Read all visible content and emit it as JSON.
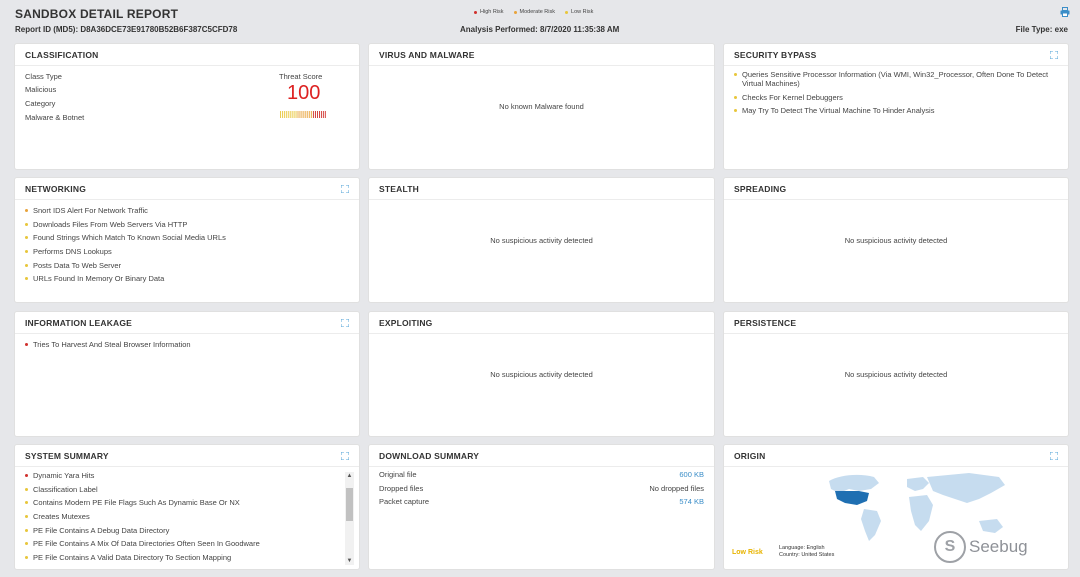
{
  "header": {
    "title": "SANDBOX DETAIL REPORT",
    "report_id": "Report ID (MD5): D8A36DCE73E91780B52B6F387C5CFD78",
    "analysis_performed": "Analysis Performed: 8/7/2020 11:35:38 AM",
    "file_type": "File Type: exe",
    "legend": [
      {
        "label": "High Risk",
        "color": "#d0312d"
      },
      {
        "label": "Moderate Risk",
        "color": "#e8a33b"
      },
      {
        "label": "Low Risk",
        "color": "#e8c63b"
      }
    ]
  },
  "colors": {
    "high": "#d0312d",
    "moderate": "#e8a33b",
    "low": "#e8c63b",
    "link": "#3b8ec8"
  },
  "classification": {
    "title": "CLASSIFICATION",
    "class_type_label": "Class Type",
    "class_type_value": "Malicious",
    "category_label": "Category",
    "category_value": "Malware & Botnet",
    "threat_score_label": "Threat Score",
    "threat_score": "100"
  },
  "virus": {
    "title": "VIRUS AND MALWARE",
    "message": "No known Malware found"
  },
  "security_bypass": {
    "title": "SECURITY BYPASS",
    "items": [
      {
        "text": "Queries Sensitive Processor Information (Via WMI, Win32_Processor, Often Done To Detect Virtual Machines)",
        "risk": "low"
      },
      {
        "text": "Checks For Kernel Debuggers",
        "risk": "low"
      },
      {
        "text": "May Try To Detect The Virtual Machine To Hinder Analysis",
        "risk": "low"
      }
    ]
  },
  "networking": {
    "title": "NETWORKING",
    "items": [
      {
        "text": "Snort IDS Alert For Network Traffic",
        "risk": "moderate"
      },
      {
        "text": "Downloads Files From Web Servers Via HTTP",
        "risk": "low"
      },
      {
        "text": "Found Strings Which Match To Known Social Media URLs",
        "risk": "low"
      },
      {
        "text": "Performs DNS Lookups",
        "risk": "low"
      },
      {
        "text": "Posts Data To Web Server",
        "risk": "low"
      },
      {
        "text": "URLs Found In Memory Or Binary Data",
        "risk": "low"
      }
    ]
  },
  "stealth": {
    "title": "STEALTH",
    "message": "No suspicious activity detected"
  },
  "spreading": {
    "title": "SPREADING",
    "message": "No suspicious activity detected"
  },
  "info_leakage": {
    "title": "INFORMATION LEAKAGE",
    "items": [
      {
        "text": "Tries To Harvest And Steal Browser Information",
        "risk": "high"
      }
    ]
  },
  "exploiting": {
    "title": "EXPLOITING",
    "message": "No suspicious activity detected"
  },
  "persistence": {
    "title": "PERSISTENCE",
    "message": "No suspicious activity detected"
  },
  "system_summary": {
    "title": "SYSTEM SUMMARY",
    "items": [
      {
        "text": "Dynamic Yara Hits",
        "risk": "high"
      },
      {
        "text": "Classification Label",
        "risk": "low"
      },
      {
        "text": "Contains Modern PE File Flags Such As Dynamic Base Or NX",
        "risk": "low"
      },
      {
        "text": "Creates Mutexes",
        "risk": "low"
      },
      {
        "text": "PE File Contains A Debug Data Directory",
        "risk": "low"
      },
      {
        "text": "PE File Contains A Mix Of Data Directories Often Seen In Goodware",
        "risk": "low"
      },
      {
        "text": "PE File Contains A Valid Data Directory To Section Mapping",
        "risk": "low"
      }
    ]
  },
  "download_summary": {
    "title": "DOWNLOAD SUMMARY",
    "rows": [
      {
        "label": "Original file",
        "value": "600 KB",
        "link": true
      },
      {
        "label": "Dropped files",
        "value": "No dropped files",
        "link": false
      },
      {
        "label": "Packet capture",
        "value": "574 KB",
        "link": true
      }
    ]
  },
  "origin": {
    "title": "ORIGIN",
    "risk": "Low Risk",
    "language_label": "Language:",
    "language": "English",
    "country_label": "Country:",
    "country": "United States"
  },
  "watermark": {
    "text": "Seebug"
  }
}
